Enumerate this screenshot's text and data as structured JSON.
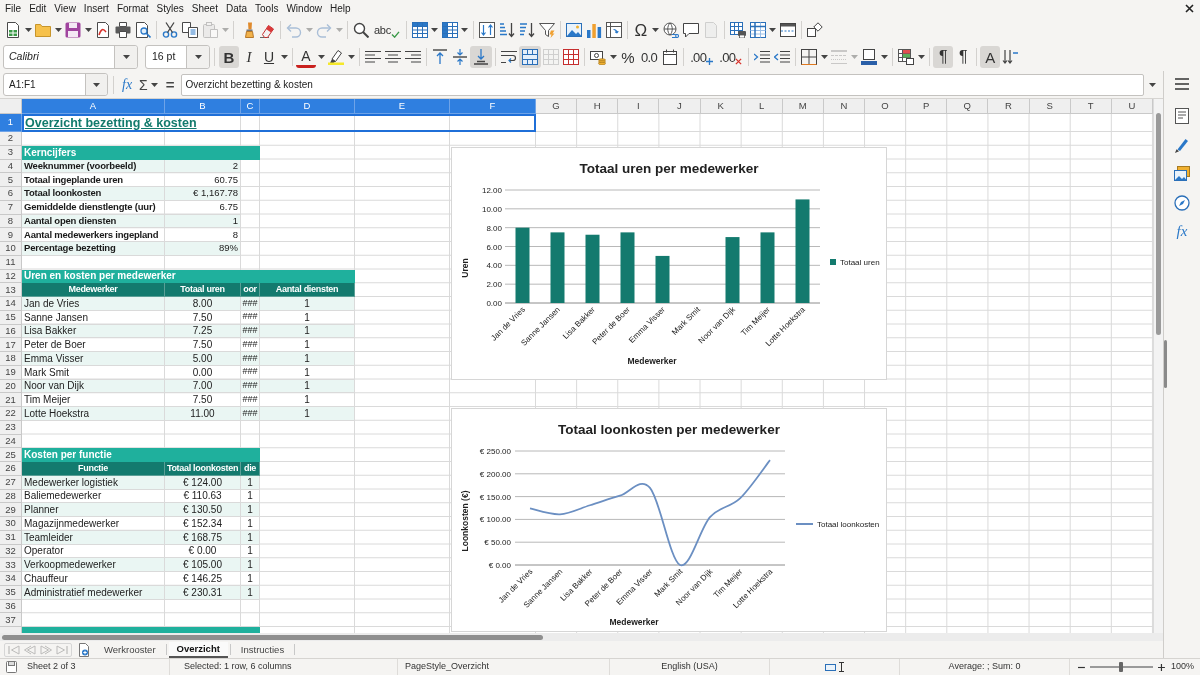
{
  "menu_bar": {
    "items": [
      "File",
      "Edit",
      "View",
      "Insert",
      "Format",
      "Styles",
      "Sheet",
      "Data",
      "Tools",
      "Window",
      "Help"
    ]
  },
  "standard_toolbar": {
    "buttons": [
      {
        "disabled": false
      },
      {
        "disabled": false
      },
      {
        "disabled": false
      },
      {
        "disabled": false
      },
      {
        "disabled": false
      },
      {
        "disabled": false
      },
      {
        "disabled": false
      },
      {
        "disabled": false
      },
      {
        "disabled": false
      },
      {
        "disabled": false
      },
      {
        "disabled": false
      },
      {
        "disabled": true
      },
      {
        "disabled": true
      },
      {
        "disabled": false
      },
      {
        "disabled": false
      },
      {
        "disabled": true
      },
      {
        "disabled": true
      },
      {
        "disabled": true
      },
      {
        "disabled": true
      },
      {
        "disabled": false
      },
      {
        "glyph": "abc",
        "disabled": false
      },
      {
        "disabled": false
      },
      {
        "disabled": false
      },
      {
        "disabled": false
      },
      {
        "disabled": false
      },
      {
        "disabled": false
      },
      {
        "disabled": false
      },
      {
        "disabled": false
      },
      {
        "disabled": false
      },
      {
        "disabled": false
      },
      {
        "disabled": false
      },
      {
        "disabled": false
      },
      {
        "glyph": "Ω",
        "disabled": false
      },
      {
        "disabled": false
      },
      {
        "disabled": false
      },
      {
        "disabled": false
      },
      {
        "disabled": true
      },
      {
        "disabled": false
      },
      {
        "disabled": false
      },
      {
        "disabled": false
      },
      {
        "disabled": false
      },
      {
        "disabled": false
      }
    ]
  },
  "formatting_toolbar": {
    "font_name": "Calibri",
    "font_size": "16 pt",
    "buttons": [
      {
        "glyph": "B",
        "on": true,
        "disabled": false
      },
      {
        "glyph": "I",
        "on": false,
        "disabled": false
      },
      {
        "glyph": "U",
        "on": false,
        "disabled": false
      },
      {
        "on": false,
        "disabled": false
      },
      {
        "glyph": "A",
        "on": false,
        "disabled": false
      },
      {
        "on": false,
        "disabled": false
      },
      {
        "on": false,
        "disabled": false
      },
      {
        "on": false,
        "disabled": false
      },
      {
        "on": false,
        "disabled": false
      },
      {
        "on": false,
        "disabled": false
      },
      {
        "on": false,
        "disabled": false
      },
      {
        "on": false,
        "disabled": false
      },
      {
        "on": false,
        "disabled": false
      },
      {
        "on": true,
        "disabled": false
      },
      {
        "on": false,
        "disabled": false
      },
      {
        "on": true,
        "disabled": false
      },
      {
        "on": false,
        "disabled": true
      },
      {
        "on": false,
        "disabled": false
      },
      {
        "on": false,
        "disabled": false
      },
      {
        "on": false,
        "disabled": false
      },
      {
        "glyph": "%",
        "on": false,
        "disabled": false
      },
      {
        "glyph": "0.0",
        "on": false,
        "disabled": false
      },
      {
        "on": false,
        "disabled": false
      },
      {
        "glyph": ".00",
        "on": false,
        "disabled": false
      },
      {
        "glyph": ".00",
        "on": false,
        "disabled": false
      },
      {
        "on": false,
        "disabled": false
      },
      {
        "on": false,
        "disabled": false
      },
      {
        "on": false,
        "disabled": false
      },
      {
        "on": false,
        "disabled": false
      },
      {
        "on": false,
        "disabled": true
      },
      {
        "on": false,
        "disabled": true
      },
      {
        "on": false,
        "disabled": false
      },
      {
        "on": false,
        "disabled": false
      },
      {
        "on": false,
        "disabled": false
      },
      {
        "on": false,
        "disabled": false
      },
      {
        "glyph": "¶",
        "on": true,
        "disabled": false
      },
      {
        "glyph": "¶",
        "on": false,
        "disabled": false
      },
      {
        "glyph": "A",
        "on": true,
        "disabled": false
      },
      {
        "on": false,
        "disabled": false
      }
    ]
  },
  "formula_bar": {
    "name_box": "A1:F1",
    "function_glyph": "fx",
    "sum_glyph": "Σ",
    "equals_glyph": "=",
    "content": "Overzicht bezetting & kosten"
  },
  "sidebar": {
    "functions_glyph": "fx"
  },
  "column_headers": [
    {
      "label": "A",
      "selected": true
    },
    {
      "label": "B",
      "selected": true
    },
    {
      "label": "C",
      "selected": true
    },
    {
      "label": "D",
      "selected": true
    },
    {
      "label": "E",
      "selected": true
    },
    {
      "label": "F",
      "selected": true
    },
    {
      "label": "G",
      "selected": false
    },
    {
      "label": "H",
      "selected": false
    },
    {
      "label": "I",
      "selected": false
    },
    {
      "label": "J",
      "selected": false
    },
    {
      "label": "K",
      "selected": false
    },
    {
      "label": "L",
      "selected": false
    },
    {
      "label": "M",
      "selected": false
    },
    {
      "label": "N",
      "selected": false
    },
    {
      "label": "O",
      "selected": false
    },
    {
      "label": "P",
      "selected": false
    },
    {
      "label": "Q",
      "selected": false
    },
    {
      "label": "R",
      "selected": false
    },
    {
      "label": "S",
      "selected": false
    },
    {
      "label": "T",
      "selected": false
    },
    {
      "label": "U",
      "selected": false
    }
  ],
  "row_headers": [
    {
      "label": "1",
      "selected": true
    },
    {
      "label": "2",
      "selected": false
    },
    {
      "label": "3",
      "selected": false
    },
    {
      "label": "4",
      "selected": false
    },
    {
      "label": "5",
      "selected": false
    },
    {
      "label": "6",
      "selected": false
    },
    {
      "label": "7",
      "selected": false
    },
    {
      "label": "8",
      "selected": false
    },
    {
      "label": "9",
      "selected": false
    },
    {
      "label": "10",
      "selected": false
    },
    {
      "label": "11",
      "selected": false
    },
    {
      "label": "12",
      "selected": false
    },
    {
      "label": "13",
      "selected": false
    },
    {
      "label": "14",
      "selected": false
    },
    {
      "label": "15",
      "selected": false
    },
    {
      "label": "16",
      "selected": false
    },
    {
      "label": "17",
      "selected": false
    },
    {
      "label": "18",
      "selected": false
    },
    {
      "label": "19",
      "selected": false
    },
    {
      "label": "20",
      "selected": false
    },
    {
      "label": "21",
      "selected": false
    },
    {
      "label": "22",
      "selected": false
    },
    {
      "label": "23",
      "selected": false
    },
    {
      "label": "24",
      "selected": false
    },
    {
      "label": "25",
      "selected": false
    },
    {
      "label": "26",
      "selected": false
    },
    {
      "label": "27",
      "selected": false
    },
    {
      "label": "28",
      "selected": false
    },
    {
      "label": "29",
      "selected": false
    },
    {
      "label": "30",
      "selected": false
    },
    {
      "label": "31",
      "selected": false
    },
    {
      "label": "32",
      "selected": false
    },
    {
      "label": "33",
      "selected": false
    },
    {
      "label": "34",
      "selected": false
    },
    {
      "label": "35",
      "selected": false
    },
    {
      "label": "36",
      "selected": false
    },
    {
      "label": "37",
      "selected": false
    }
  ],
  "sheet": {
    "title": {
      "text": "Overzicht bezetting & kosten",
      "selected": true
    },
    "key_figures": {
      "heading": "Kerncijfers",
      "rows": [
        {
          "label": "Weeknummer (voorbeeld)",
          "value": "2"
        },
        {
          "label": "Totaal ingeplande uren",
          "value": "60.75"
        },
        {
          "label": "Totaal loonkosten",
          "value": "€ 1,167.78"
        },
        {
          "label": "Gemiddelde dienstlengte (uur)",
          "value": "6.75"
        },
        {
          "label": "Aantal open diensten",
          "value": "1"
        },
        {
          "label": "Aantal medewerkers ingepland",
          "value": "8"
        },
        {
          "label": "Percentage bezetting",
          "value": "89%"
        }
      ]
    },
    "hours_and_costs_per_employee": {
      "heading": "Uren en kosten per medewerker",
      "columns": [
        "Medewerker",
        "Totaal uren",
        "oor",
        "Aantal diensten"
      ],
      "rows": [
        [
          "Jan de Vries",
          "8.00",
          "###",
          "1"
        ],
        [
          "Sanne Jansen",
          "7.50",
          "###",
          "1"
        ],
        [
          "Lisa Bakker",
          "7.25",
          "###",
          "1"
        ],
        [
          "Peter de Boer",
          "7.50",
          "###",
          "1"
        ],
        [
          "Emma Visser",
          "5.00",
          "###",
          "1"
        ],
        [
          "Mark Smit",
          "0.00",
          "###",
          "1"
        ],
        [
          "Noor van Dijk",
          "7.00",
          "###",
          "1"
        ],
        [
          "Tim Meijer",
          "7.50",
          "###",
          "1"
        ],
        [
          "Lotte Hoekstra",
          "11.00",
          "###",
          "1"
        ]
      ]
    },
    "costs_per_function": {
      "heading": "Kosten per functie",
      "columns": [
        "Functie",
        "Totaal loonkosten",
        "die"
      ],
      "rows": [
        [
          "Medewerker logistiek",
          "€ 124.00",
          "1"
        ],
        [
          "Baliemedewerker",
          "€ 110.63",
          "1"
        ],
        [
          "Planner",
          "€ 130.50",
          "1"
        ],
        [
          "Magazijnmedewerker",
          "€ 152.34",
          "1"
        ],
        [
          "Teamleider",
          "€ 168.75",
          "1"
        ],
        [
          "Operator",
          "€ 0.00",
          "1"
        ],
        [
          "Verkoopmedewerker",
          "€ 105.00",
          "1"
        ],
        [
          "Chauffeur",
          "€ 146.25",
          "1"
        ],
        [
          "Administratief medewerker",
          "€ 230.31",
          "1"
        ]
      ]
    },
    "section_band_below": true
  },
  "charts": [
    {
      "chart_data": {
        "type": "bar",
        "title": "Totaal uren per medewerker",
        "xlabel": "Medewerker",
        "ylabel": "Uren",
        "categories": [
          "Jan de Vries",
          "Sanne Jansen",
          "Lisa Bakker",
          "Peter de Boer",
          "Emma Visser",
          "Mark Smit",
          "Noor van Dijk",
          "Tim Meijer",
          "Lotte Hoekstra"
        ],
        "series": [
          {
            "name": "Totaal uren",
            "color": "#137a6e",
            "values": [
              8,
              7.5,
              7.25,
              7.5,
              5,
              0,
              7,
              7.5,
              11
            ]
          }
        ],
        "ylim": [
          0,
          12
        ],
        "yticks": [
          {
            "value": 0,
            "label": "0.00"
          },
          {
            "value": 2,
            "label": "2.00"
          },
          {
            "value": 4,
            "label": "4.00"
          },
          {
            "value": 6,
            "label": "6.00"
          },
          {
            "value": 8,
            "label": "8.00"
          },
          {
            "value": 10,
            "label": "10.00"
          },
          {
            "value": 12,
            "label": "12.00"
          }
        ],
        "grid": true
      }
    },
    {
      "chart_data": {
        "type": "line",
        "title": "Totaal loonkosten per medewerker",
        "xlabel": "Medewerker",
        "ylabel": "Loonkosten (€)",
        "categories": [
          "Jan de Vries",
          "Sanne Jansen",
          "Lisa Bakker",
          "Peter de Boer",
          "Emma Visser",
          "Mark Smit",
          "Noor van Dijk",
          "Tim Meijer",
          "Lotte Hoekstra"
        ],
        "series": [
          {
            "name": "Totaal loonkosten",
            "color": "#6b8fc2",
            "values": [
              124,
              111,
              131,
              152,
              169,
              0,
              105,
              146,
              230
            ]
          }
        ],
        "ylim": [
          0,
          250
        ],
        "yticks": [
          {
            "value": 0,
            "label": "€ 0.00"
          },
          {
            "value": 50,
            "label": "€ 50.00"
          },
          {
            "value": 100,
            "label": "€ 100.00"
          },
          {
            "value": 150,
            "label": "€ 150.00"
          },
          {
            "value": 200,
            "label": "€ 200.00"
          },
          {
            "value": 250,
            "label": "€ 250.00"
          }
        ],
        "grid": true
      }
    }
  ],
  "sheet_tabs": {
    "navigation": [
      {
        "disabled": true
      },
      {
        "disabled": true
      },
      {
        "disabled": true
      },
      {
        "disabled": true
      }
    ],
    "tabs": [
      {
        "label": "Werkrooster",
        "selected": false
      },
      {
        "label": "Overzicht",
        "selected": true
      },
      {
        "label": "Instructies",
        "selected": false
      }
    ]
  },
  "status_bar": {
    "sheet": "Sheet 2 of 3",
    "selection": "Selected: 1 row, 6 columns",
    "page_style": "PageStyle_Overzicht",
    "language": "English (USA)",
    "summary": "Average: ; Sum: 0",
    "zoom": {
      "level": 0.49,
      "reading": "100%"
    }
  }
}
